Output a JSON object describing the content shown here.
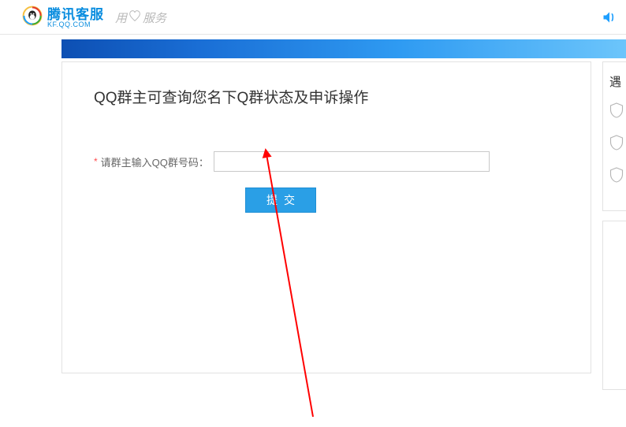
{
  "header": {
    "brand": "腾讯客服",
    "brand_sub": "KF.QQ.COM",
    "slogan_prefix": "用",
    "slogan_suffix": "服务"
  },
  "main": {
    "title": "QQ群主可查询您名下Q群状态及申诉操作",
    "form": {
      "group_label": "请群主输入QQ群号码：",
      "group_value": "",
      "submit_label": "提交"
    }
  },
  "sidebar": {
    "title": "遇"
  }
}
